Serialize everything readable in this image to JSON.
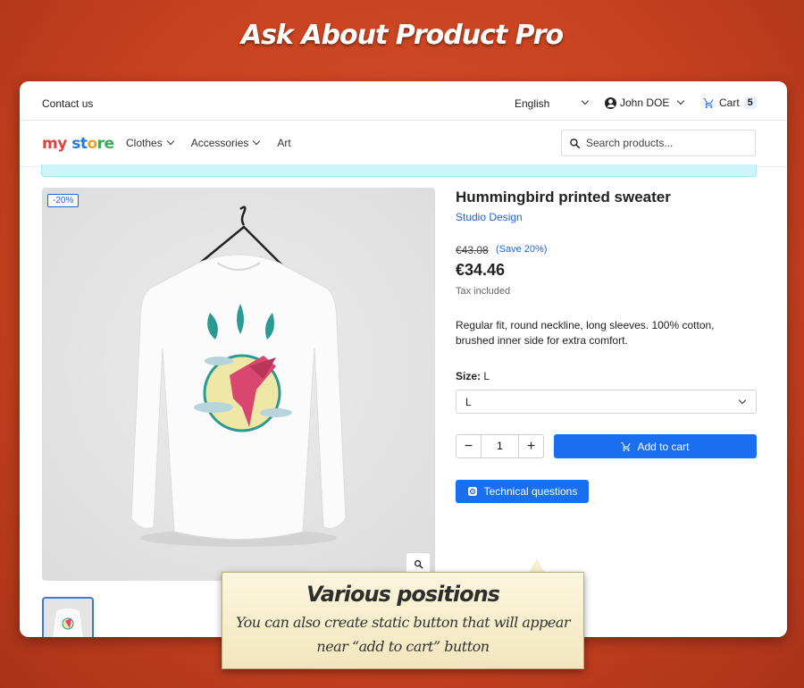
{
  "banner": {
    "title": "Ask About Product Pro"
  },
  "topbar": {
    "contact": "Contact us",
    "language": "English",
    "user": "John DOE",
    "cart_label": "Cart",
    "cart_count": "5"
  },
  "navbar": {
    "logo_parts": [
      "my",
      " st",
      "o",
      "re"
    ],
    "menu": [
      "Clothes",
      "Accessories",
      "Art"
    ],
    "search_placeholder": "Search products..."
  },
  "product": {
    "discount_badge": "-20%",
    "name": "Hummingbird printed sweater",
    "brand": "Studio Design",
    "old_price": "€43.08",
    "save": "(Save 20%)",
    "price": "€34.46",
    "tax": "Tax included",
    "description": "Regular fit, round neckline, long sleeves. 100% cotton, brushed inner side for extra comfort.",
    "size_label": "Size:",
    "size_value": "L",
    "size_selected": "L",
    "quantity": "1",
    "add_to_cart": "Add to cart",
    "technical_questions": "Technical questions"
  },
  "callout": {
    "title": "Various positions",
    "line1": "You can also create static button that will appear",
    "line2": "near “add to cart” button"
  },
  "colors": {
    "accent": "#1a6ff0",
    "background": "#c8421f"
  }
}
